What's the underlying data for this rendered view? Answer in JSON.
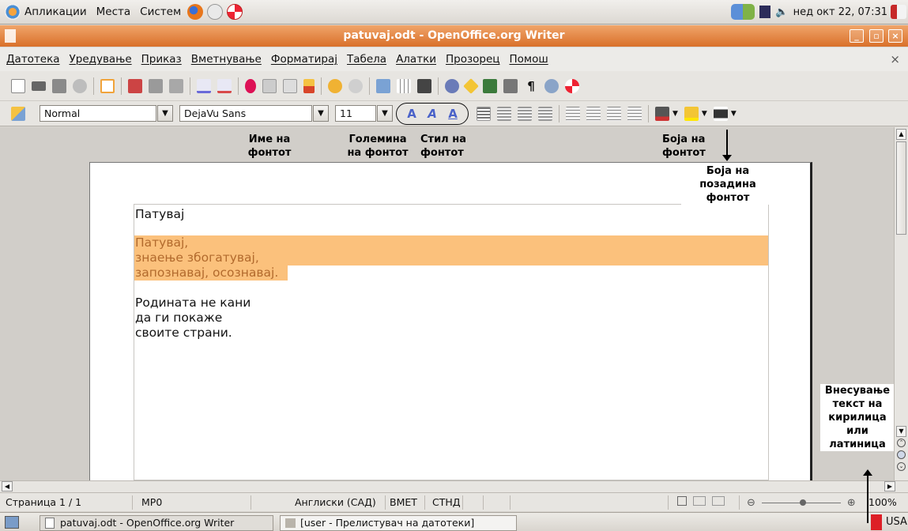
{
  "top_panel": {
    "menu_applications": "Апликации",
    "menu_places": "Места",
    "menu_system": "Систем",
    "clock": "нед окт 22, 07:31"
  },
  "window": {
    "title": "patuvaj.odt - OpenOffice.org Writer",
    "close_doc": "×"
  },
  "menubar": {
    "items": [
      "Датотека",
      "Уредување",
      "Приказ",
      "Вметнување",
      "Форматирај",
      "Табела",
      "Алатки",
      "Прозорец",
      "Помош"
    ]
  },
  "formatting": {
    "style": "Normal",
    "font_name": "DejaVu Sans",
    "font_size": "11"
  },
  "document": {
    "line1": "Патувај",
    "highlight_lines": [
      "Патувај,",
      "знаење збогатувај,",
      "запознавај, осознавај."
    ],
    "plain_lines": [
      "Родината не кани",
      "да ги покаже",
      "своите страни."
    ],
    "highlight_bg": "#fbc17c",
    "highlight_fg": "#b26a2d"
  },
  "annotations": {
    "font_name": [
      "Име на",
      "фонтот"
    ],
    "font_size": [
      "Големина",
      "на фонтот"
    ],
    "font_style": [
      "Стил на",
      "фонтот"
    ],
    "font_color": [
      "Боја на",
      "фонтот"
    ],
    "bg_color": [
      "Боја на",
      "позадина",
      "фонтот"
    ],
    "input_lang": [
      "Внесување",
      "текст на",
      "кирилица",
      "или",
      "латиница"
    ]
  },
  "statusbar": {
    "page": "Страница 1 / 1",
    "style": "МР0",
    "language": "Англиски (САД)",
    "insert": "ВМЕТ",
    "selection": "СТНД",
    "zoom": "100%"
  },
  "taskbar": {
    "task1": "patuvaj.odt - OpenOffice.org Writer",
    "task2": "[user - Прелистувач на датотеки]",
    "keyboard": "USA",
    "keyboard_color": "#dd1f26"
  }
}
